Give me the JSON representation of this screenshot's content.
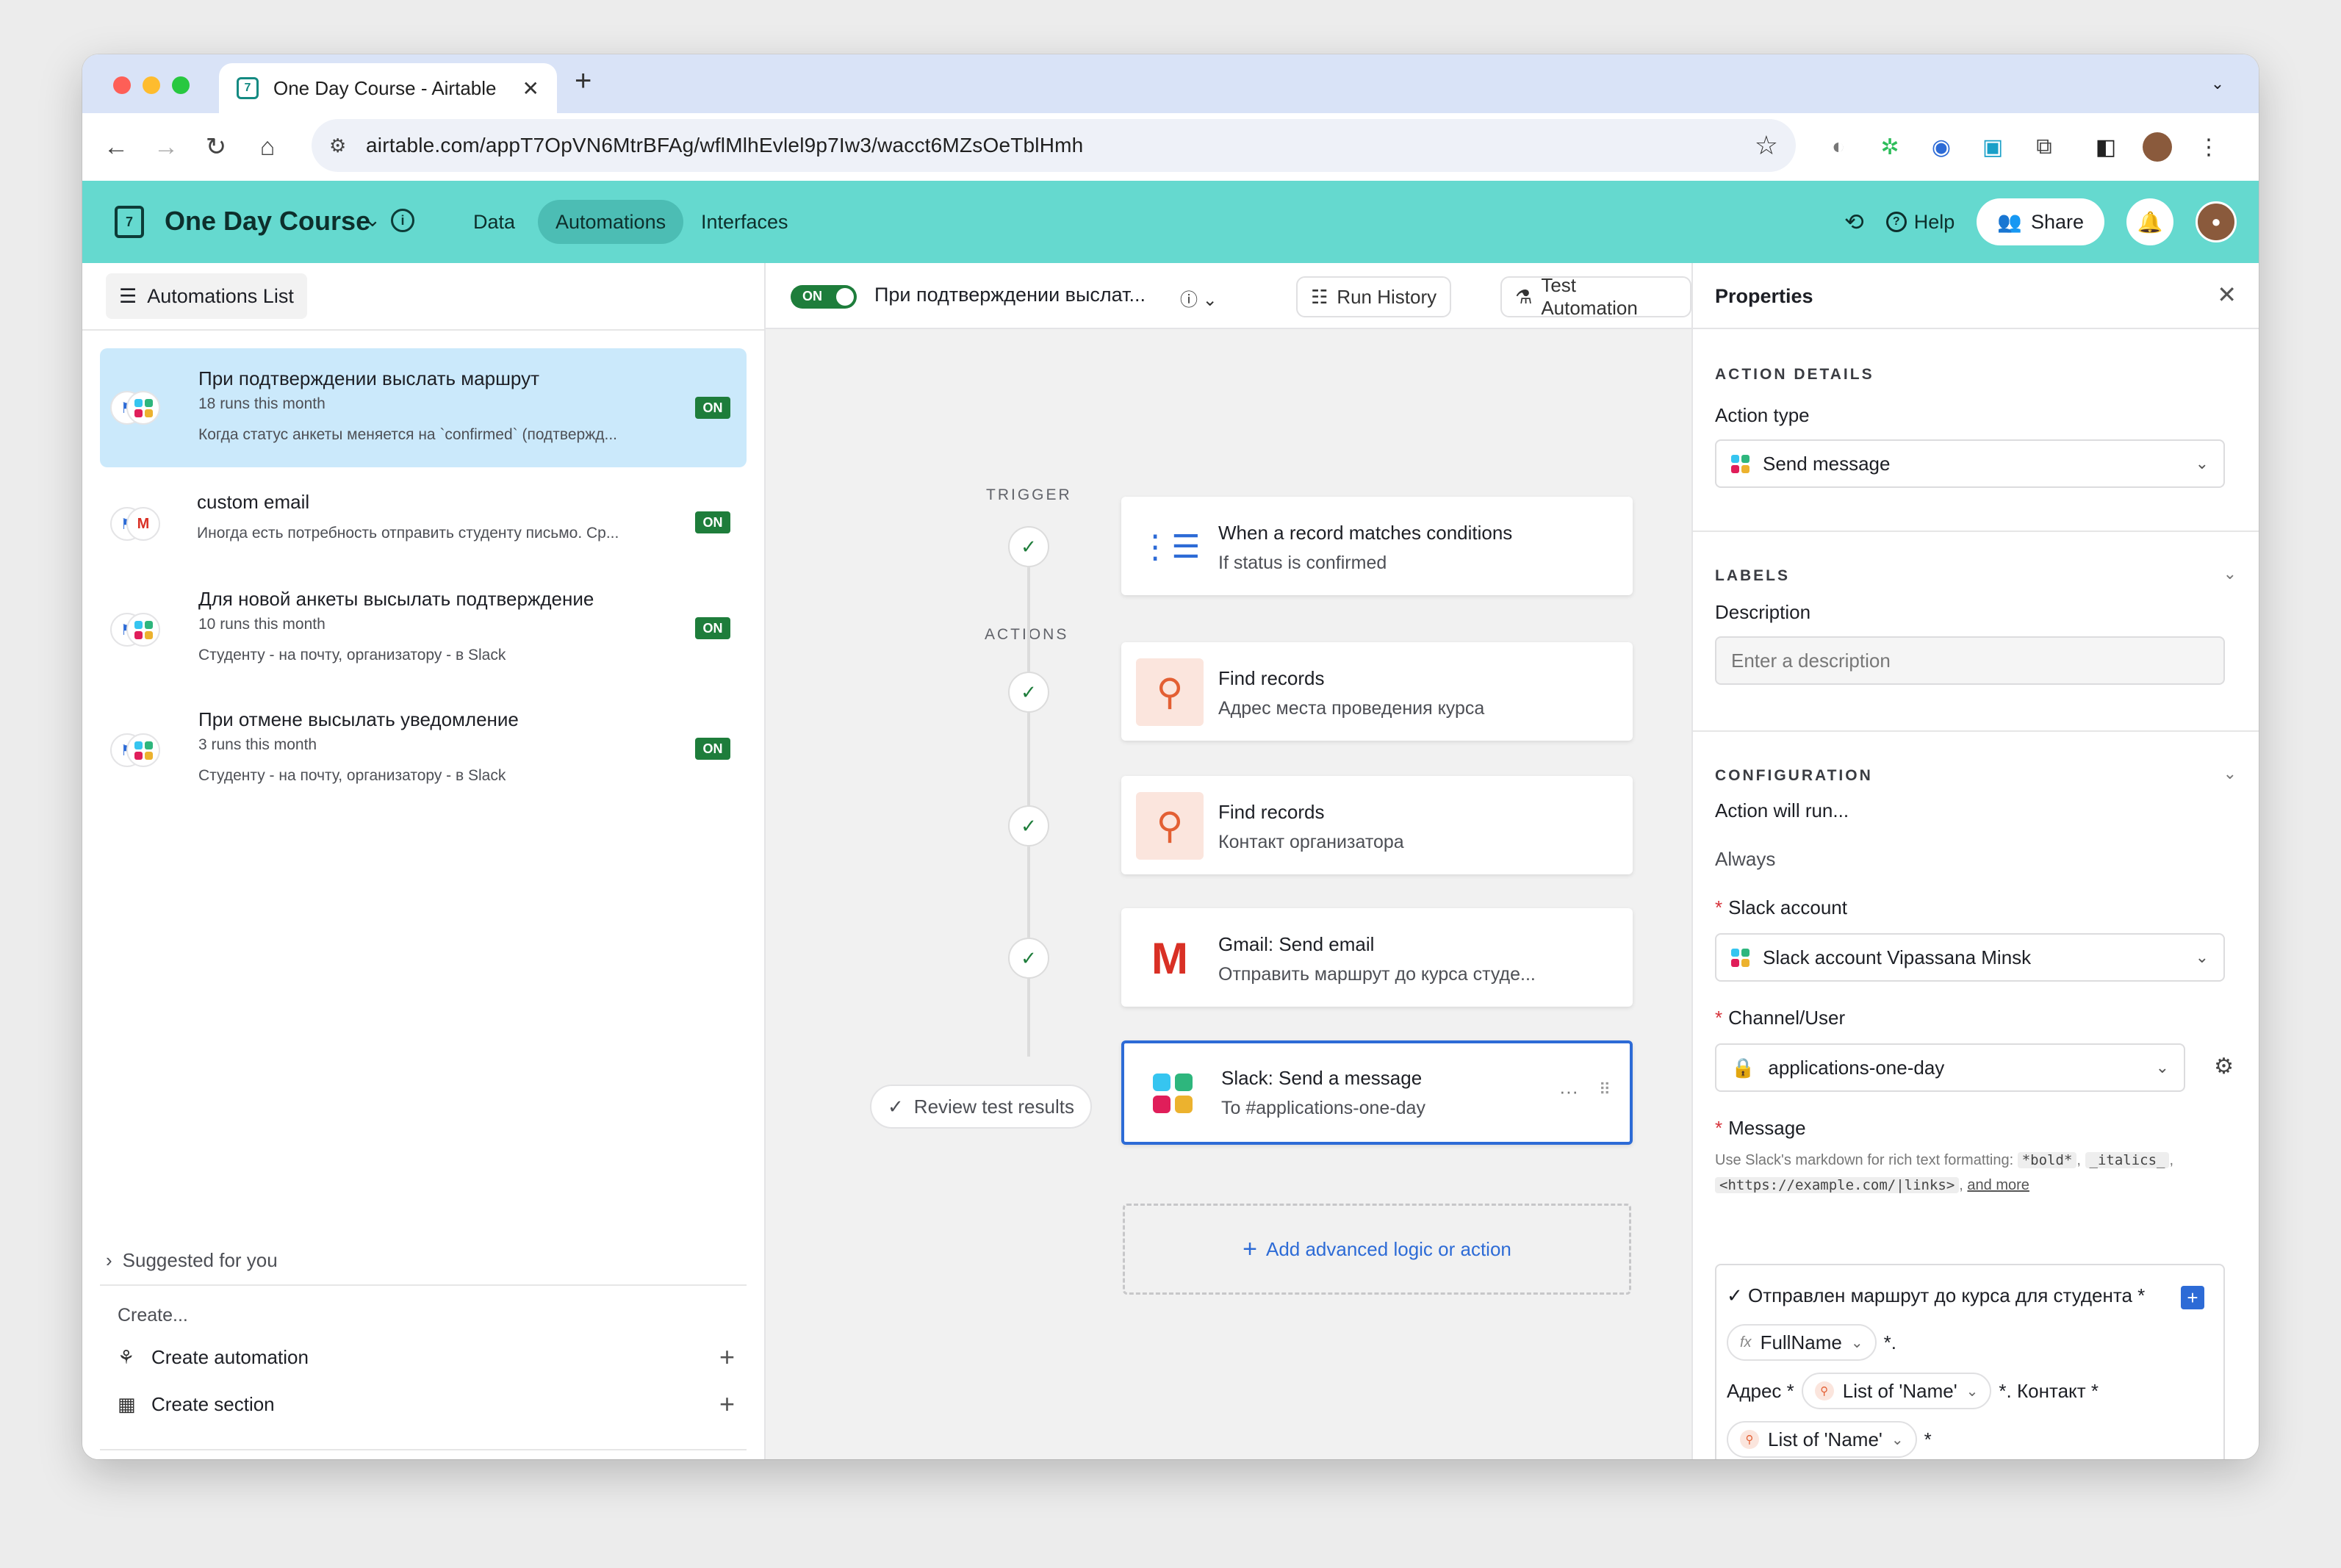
{
  "browser": {
    "tab_title": "One Day Course - Airtable",
    "url": "airtable.com/appT7OpVN6MtrBFAg/wflMlhEvlel9p7Iw3/wacct6MZsOeTblHmh"
  },
  "header": {
    "base_name": "One Day Course",
    "nav": [
      "Data",
      "Automations",
      "Interfaces"
    ],
    "active_nav": "Automations",
    "help_label": "Help",
    "share_label": "Share",
    "accent": "#65d9cf"
  },
  "left": {
    "list_button": "Automations List",
    "items": [
      {
        "title": "При подтверждении выслать маршрут",
        "runs": "18 runs this month",
        "desc": "Когда статус анкеты меняется на `confirmed` (подтвержд...",
        "status": "ON"
      },
      {
        "title": "custom email",
        "runs": "",
        "desc": "Иногда есть потребность отправить студенту письмо. Ср...",
        "status": "ON"
      },
      {
        "title": "Для новой анкеты высылать подтверждение",
        "runs": "10 runs this month",
        "desc": "Студенту - на почту, организатору - в Slack",
        "status": "ON"
      },
      {
        "title": "При отмене высылать уведомление",
        "runs": "3 runs this month",
        "desc": "Студенту - на почту, организатору - в Slack",
        "status": "ON"
      }
    ],
    "create_label": "Create...",
    "create_automation": "Create automation",
    "create_section": "Create section",
    "suggested": "Suggested for you"
  },
  "center": {
    "toggle": "ON",
    "flow_title": "При подтверждении выслат...",
    "run_history": "Run History",
    "test_automation": "Test Automation",
    "trigger_label": "TRIGGER",
    "actions_label": "ACTIONS",
    "trigger": {
      "title": "When a record matches conditions",
      "sub": "If status is confirmed"
    },
    "actions": [
      {
        "title": "Find records",
        "sub": "Адрес места проведения курса"
      },
      {
        "title": "Find records",
        "sub": "Контакт организатора"
      },
      {
        "title": "Gmail: Send email",
        "sub": "Отправить маршрут до курса студе..."
      },
      {
        "title": "Slack: Send a message",
        "sub": "To #applications-one-day"
      }
    ],
    "review": "Review test results",
    "add_action": "Add advanced logic or action"
  },
  "right": {
    "title": "Properties",
    "action_details": "ACTION DETAILS",
    "action_type_label": "Action type",
    "action_type_value": "Send message",
    "labels": "LABELS",
    "description_label": "Description",
    "description_placeholder": "Enter a description",
    "configuration": "CONFIGURATION",
    "action_run_label": "Action will run...",
    "action_run_value": "Always",
    "slack_account_label": "Slack account",
    "slack_account_value": "Slack account Vipassana Minsk",
    "channel_label": "Channel/User",
    "channel_value": "applications-one-day",
    "message_label": "Message",
    "hint_prefix": "Use Slack's markdown for rich text formatting:",
    "hint_bold": "*bold*",
    "hint_italics": "_italics_",
    "hint_link": "<https://example.com/|links>",
    "hint_more": "and more",
    "msg_line1": "✓ Отправлен маршрут до курса для студента *",
    "token_fullname": "FullName",
    "msg_after_name": "*.",
    "msg_address": "Адрес *",
    "token_list_name": "List of 'Name'",
    "msg_contact": "*. Контакт *",
    "msg_star": "*"
  }
}
